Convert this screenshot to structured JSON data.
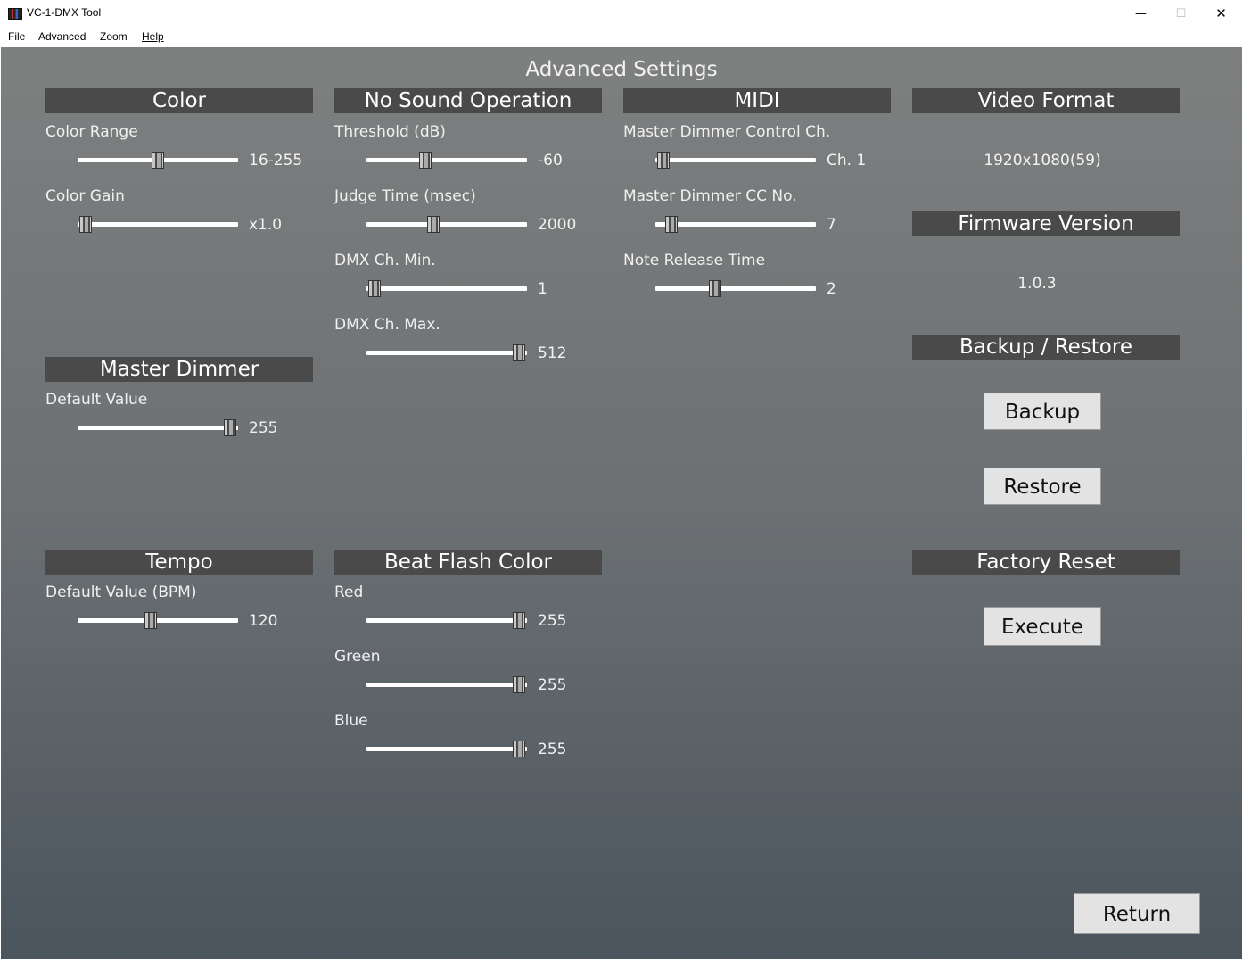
{
  "window": {
    "title": "VC-1-DMX Tool",
    "minimize_glyph": "—",
    "maximize_glyph": "☐",
    "close_glyph": "✕"
  },
  "menu": {
    "file": "File",
    "advanced": "Advanced",
    "zoom": "Zoom",
    "help": "Help"
  },
  "page_title": "Advanced Settings",
  "color": {
    "header": "Color",
    "range": {
      "label": "Color Range",
      "value_text": "16-255",
      "level": 0.5
    },
    "gain": {
      "label": "Color Gain",
      "value_text": "x1.0",
      "level": 0.0
    }
  },
  "no_sound": {
    "header": "No Sound Operation",
    "threshold": {
      "label": "Threshold (dB)",
      "value_text": "-60",
      "level": 0.35
    },
    "judge_time": {
      "label": "Judge Time (msec)",
      "value_text": "2000",
      "level": 0.41
    },
    "dmx_min": {
      "label": "DMX Ch. Min.",
      "value_text": "1",
      "level": 0.0
    },
    "dmx_max": {
      "label": "DMX Ch. Max.",
      "value_text": "512",
      "level": 1.0
    }
  },
  "midi": {
    "header": "MIDI",
    "master_ch": {
      "label": "Master Dimmer Control Ch.",
      "value_text": "Ch. 1",
      "level": 0.0
    },
    "cc_no": {
      "label": "Master Dimmer CC No.",
      "value_text": "7",
      "level": 0.055
    },
    "note_release": {
      "label": "Note Release Time",
      "value_text": "2",
      "level": 0.36
    }
  },
  "video_format": {
    "header": "Video Format",
    "value": "1920x1080(59)"
  },
  "firmware": {
    "header": "Firmware Version",
    "value": "1.0.3"
  },
  "backup_restore": {
    "header": "Backup / Restore",
    "backup_label": "Backup",
    "restore_label": "Restore"
  },
  "master_dimmer": {
    "header": "Master Dimmer",
    "default": {
      "label": "Default Value",
      "value_text": "255",
      "level": 1.0
    }
  },
  "tempo": {
    "header": "Tempo",
    "default": {
      "label": "Default Value (BPM)",
      "value_text": "120",
      "level": 0.45
    }
  },
  "beat_flash": {
    "header": "Beat Flash Color",
    "red": {
      "label": "Red",
      "value_text": "255",
      "level": 1.0
    },
    "green": {
      "label": "Green",
      "value_text": "255",
      "level": 1.0
    },
    "blue": {
      "label": "Blue",
      "value_text": "255",
      "level": 1.0
    }
  },
  "factory_reset": {
    "header": "Factory Reset",
    "execute_label": "Execute"
  },
  "return_label": "Return"
}
